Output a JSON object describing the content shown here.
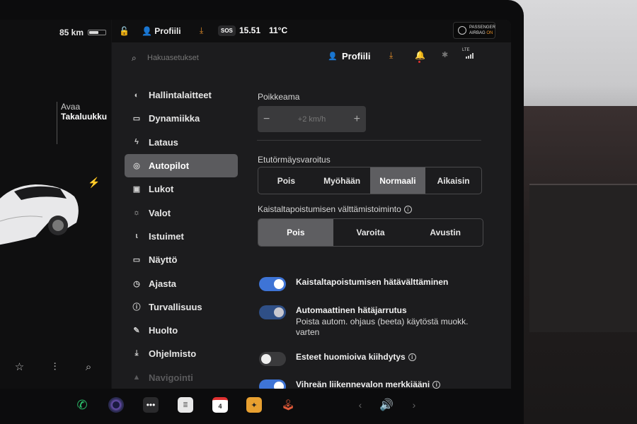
{
  "status": {
    "range": "85 km",
    "battery_level": 0.6,
    "profile": "Profiili",
    "sos": "SOS",
    "time": "15.51",
    "temperature": "11°C",
    "airbag_line1": "PASSENGER",
    "airbag_line2": "AIRBAG",
    "airbag_state": "ON"
  },
  "car": {
    "trunk_line1": "Avaa",
    "trunk_line2": "Takaluukku"
  },
  "search": {
    "placeholder": "Hakuasetukset"
  },
  "header": {
    "profile": "Profiili",
    "network": "LTE"
  },
  "nav": {
    "items": [
      {
        "label": "Hallintalaitteet",
        "icon": "toggle-icon"
      },
      {
        "label": "Dynamiikka",
        "icon": "car-icon"
      },
      {
        "label": "Lataus",
        "icon": "bolt-icon"
      },
      {
        "label": "Autopilot",
        "icon": "steering-wheel-icon"
      },
      {
        "label": "Lukot",
        "icon": "lock-icon"
      },
      {
        "label": "Valot",
        "icon": "sun-icon"
      },
      {
        "label": "Istuimet",
        "icon": "seat-icon"
      },
      {
        "label": "Näyttö",
        "icon": "display-icon"
      },
      {
        "label": "Ajasta",
        "icon": "alarm-icon"
      },
      {
        "label": "Turvallisuus",
        "icon": "alert-circle-icon"
      },
      {
        "label": "Huolto",
        "icon": "wrench-icon"
      },
      {
        "label": "Ohjelmisto",
        "icon": "download-icon"
      },
      {
        "label": "Navigointi",
        "icon": "navigation-icon"
      }
    ],
    "active": "Autopilot"
  },
  "autopilot": {
    "offset_label": "Poikkeama",
    "offset_value": "+2 km/h",
    "fcw_label": "Etutörmäysvaroitus",
    "fcw_options": [
      "Pois",
      "Myöhään",
      "Normaali",
      "Aikaisin"
    ],
    "fcw_selected": "Normaali",
    "lane_label": "Kaistaltapoistumisen välttämistoiminto",
    "lane_options": [
      "Pois",
      "Varoita",
      "Avustin"
    ],
    "lane_selected": "Pois",
    "toggles": [
      {
        "label": "Kaistaltapoistumisen hätävälttäminen",
        "sub": "",
        "state": "on"
      },
      {
        "label": "Automaattinen hätäjarrutus",
        "sub": "Poista autom. ohjaus (beeta) käytöstä muokk. varten",
        "state": "on-disabled"
      },
      {
        "label": "Esteet huomioiva kiihdytys",
        "sub": "",
        "state": "off",
        "info": true
      },
      {
        "label": "Vihreän liikennevalon merkkiääni",
        "sub": "",
        "state": "on",
        "info": true
      }
    ]
  },
  "dock": {
    "calendar_day": "4"
  }
}
